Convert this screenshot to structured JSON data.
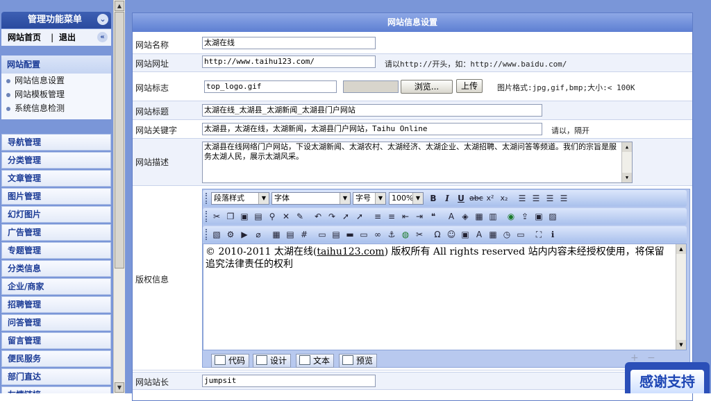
{
  "sidebar": {
    "title": "管理功能菜单",
    "home": "网站首页",
    "separator": "|",
    "logout": "退出",
    "config": {
      "heading": "网站配置",
      "items": [
        "网站信息设置",
        "网站模板管理",
        "系统信息检测"
      ]
    },
    "nav": [
      "导航管理",
      "分类管理",
      "文章管理",
      "图片管理",
      "幻灯图片",
      "广告管理",
      "专题管理",
      "分类信息",
      "企业/商家",
      "招聘管理",
      "问答管理",
      "留言管理",
      "便民服务",
      "部门直达",
      "友情链接"
    ]
  },
  "panel": {
    "title": "网站信息设置"
  },
  "form": {
    "site_name": {
      "label": "网站名称",
      "value": "太湖在线"
    },
    "site_url": {
      "label": "网站网址",
      "value": "http://www.taihu123.com/",
      "hint": "请以http://开头，如：http://www.baidu.com/"
    },
    "site_logo": {
      "label": "网站标志",
      "value": "top_logo.gif",
      "browse": "浏览...",
      "upload": "上传",
      "hint": "图片格式:jpg,gif,bmp;大小:< 100K"
    },
    "site_title": {
      "label": "网站标题",
      "value": "太湖在线_太湖县_太湖新闻_太湖县门户网站"
    },
    "site_keywords": {
      "label": "网站关键字",
      "value": "太湖县，太湖在线，太湖新闻，太湖县门户网站，Taihu Online",
      "hint": "请以，隔开"
    },
    "site_desc": {
      "label": "网站描述",
      "value": "太湖县在线网络门户网站，下设太湖新闻、太湖农村、太湖经济、太湖企业、太湖招聘、太湖问答等频道。我们的宗旨是服务太湖人民，展示太湖风采。"
    },
    "copyright": {
      "label": "版权信息",
      "text_before": "© 2010-2011 太湖在线(",
      "link": "taihu123.com",
      "text_after": ") 版权所有  All rights reserved  站内内容未经授权使用，将保留追究法律责任的权利"
    },
    "webmaster": {
      "label": "网站站长",
      "value": "jumpsit"
    }
  },
  "editor": {
    "selects": {
      "paragraph": "段落样式",
      "font": "字体",
      "size": "字号",
      "zoom": "100%"
    },
    "modes": [
      "代码",
      "设计",
      "文本",
      "预览"
    ]
  },
  "float_badge": "感谢支持",
  "colors": {
    "accent": "#2a4a9e",
    "sidebar_bg": "#7a96d8",
    "panel_header": "#5d7fd2"
  }
}
